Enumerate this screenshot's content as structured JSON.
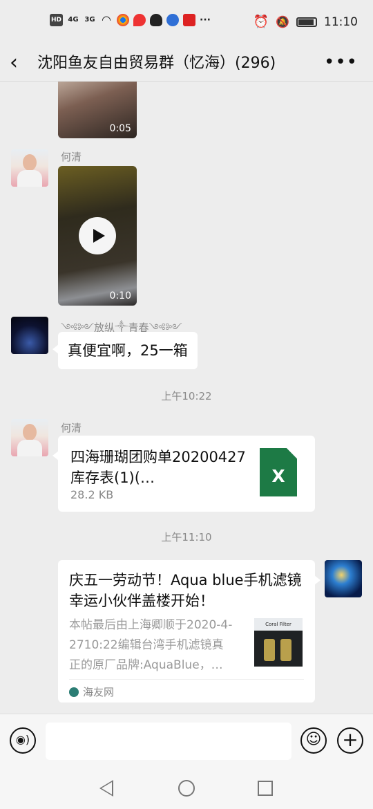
{
  "status_bar": {
    "left_icons": [
      "HD",
      "4G",
      "3G",
      "wifi",
      "chrome",
      "maps",
      "qq",
      "baidu",
      "app"
    ],
    "hd_label": "HD",
    "sig1_label": "4G",
    "sig2_label": "3G",
    "overflow": "···",
    "time": "11:10"
  },
  "header": {
    "title": "沈阳鱼友自由贸易群（忆海）(296)"
  },
  "messages": {
    "video1": {
      "duration": "0:05"
    },
    "heqing1": {
      "sender": "何清",
      "duration": "0:10"
    },
    "text1": {
      "sender": "༺༻放纵༒青春༺༻",
      "text": "真便宜啊，25一箱"
    },
    "time1": "上午10:22",
    "heqing2": {
      "sender": "何清",
      "file_name": "四海珊瑚团购单20200427 库存表(1)(…",
      "file_size": "28.2 KB",
      "file_icon": "X"
    },
    "time2": "上午11:10",
    "link": {
      "title": "庆五一劳动节！Aqua blue手机滤镜幸运小伙伴盖楼开始！",
      "desc": "本帖最后由上海卿顺于2020-4-2710:22编辑台湾手机滤镜真正的原厂品牌:AquaBlue，…",
      "thumb_label": "Coral Filter",
      "source": "海友网"
    }
  },
  "input_bar": {
    "voice_icon": "voice-icon",
    "emoji_icon": "emoji-icon",
    "plus_icon": "plus-icon"
  }
}
